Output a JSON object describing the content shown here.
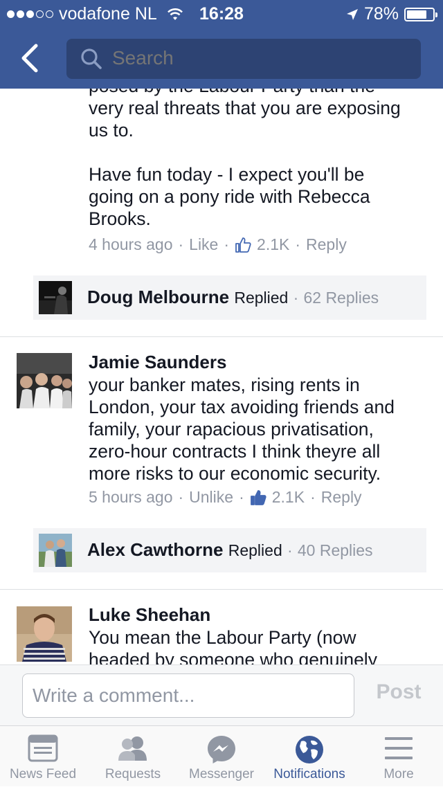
{
  "status_bar": {
    "carrier": "vodafone NL",
    "time": "16:28",
    "battery": "78%",
    "battery_level": 0.78,
    "signal_bars_filled": 3,
    "signal_bars_total": 5
  },
  "header": {
    "search_placeholder": "Search",
    "bg_color": "#3b5998"
  },
  "comments": [
    {
      "text_lines": [
        "posed by the Labour Party than the",
        "very real threats that you are exposing",
        "us to.",
        "",
        "Have fun today - I expect you'll be",
        "going on a pony ride with Rebecca",
        "Brooks."
      ],
      "time": "4 hours ago",
      "action": "Like",
      "likes": "2.1K",
      "reply": "Reply",
      "reply_summary": {
        "name": "Doug Melbourne",
        "replied": "Replied",
        "count": "62 Replies"
      }
    },
    {
      "author": "Jamie Saunders",
      "text_lines": [
        "your banker mates, rising rents in",
        "London, your tax avoiding friends and",
        "family, your rapacious privatisation,",
        "zero-hour contracts I think theyre all",
        "more risks to our economic security."
      ],
      "time": "5 hours ago",
      "action": "Unlike",
      "likes": "2.1K",
      "reply": "Reply",
      "reply_summary": {
        "name": "Alex Cawthorne",
        "replied": "Replied",
        "count": "40 Replies"
      }
    },
    {
      "author": "Luke Sheehan",
      "text_lines": [
        "You mean the Labour Party (now",
        "headed by someone who genuinely"
      ]
    }
  ],
  "composer": {
    "placeholder": "Write a comment...",
    "post_label": "Post"
  },
  "tabs": [
    {
      "label": "News Feed",
      "icon": "news-feed-icon"
    },
    {
      "label": "Requests",
      "icon": "friend-requests-icon"
    },
    {
      "label": "Messenger",
      "icon": "messenger-icon"
    },
    {
      "label": "Notifications",
      "icon": "globe-icon",
      "active": true
    },
    {
      "label": "More",
      "icon": "hamburger-menu-icon"
    }
  ],
  "colors": {
    "brand": "#3b5998",
    "link_blue": "#4267b2",
    "meta_gray": "#9197a3"
  }
}
